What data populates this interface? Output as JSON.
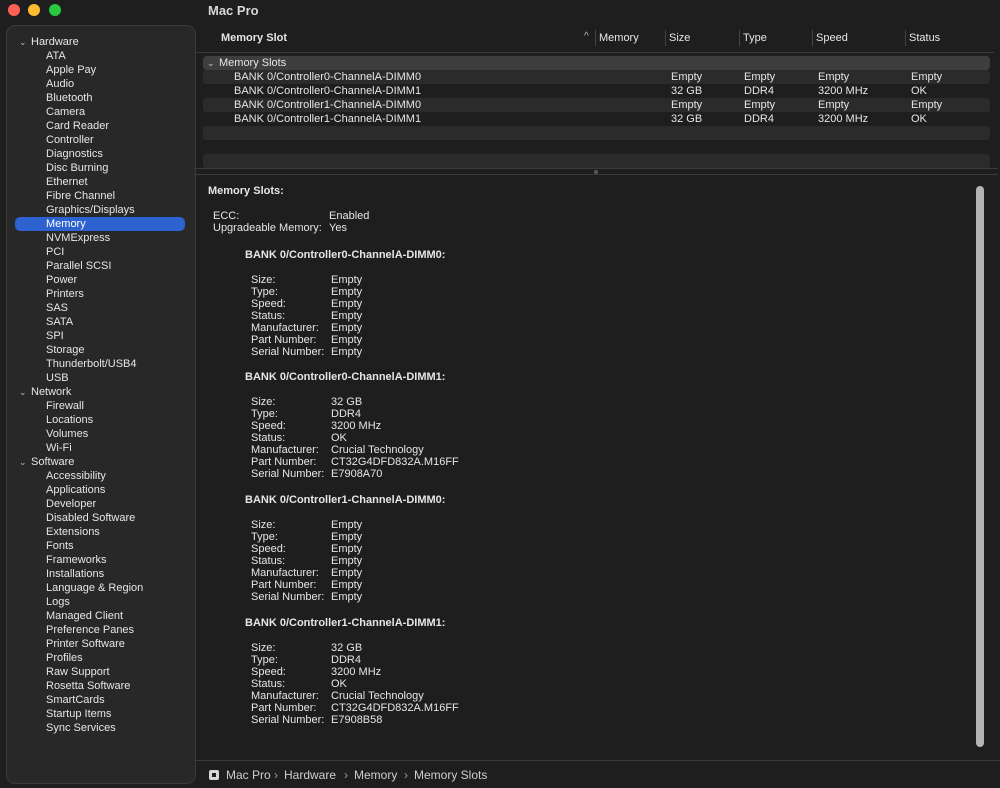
{
  "window": {
    "title": "Mac Pro"
  },
  "sidebar": {
    "hardware": {
      "label": "Hardware",
      "items": [
        "ATA",
        "Apple Pay",
        "Audio",
        "Bluetooth",
        "Camera",
        "Card Reader",
        "Controller",
        "Diagnostics",
        "Disc Burning",
        "Ethernet",
        "Fibre Channel",
        "Graphics/Displays",
        "Memory",
        "NVMExpress",
        "PCI",
        "Parallel SCSI",
        "Power",
        "Printers",
        "SAS",
        "SATA",
        "SPI",
        "Storage",
        "Thunderbolt/USB4",
        "USB"
      ],
      "selected": "Memory"
    },
    "network": {
      "label": "Network",
      "items": [
        "Firewall",
        "Locations",
        "Volumes",
        "Wi-Fi"
      ]
    },
    "software": {
      "label": "Software",
      "items": [
        "Accessibility",
        "Applications",
        "Developer",
        "Disabled Software",
        "Extensions",
        "Fonts",
        "Frameworks",
        "Installations",
        "Language & Region",
        "Logs",
        "Managed Client",
        "Preference Panes",
        "Printer Software",
        "Profiles",
        "Raw Support",
        "Rosetta Software",
        "SmartCards",
        "Startup Items",
        "Sync Services"
      ]
    }
  },
  "table": {
    "columns": [
      "Memory Slot",
      "Memory",
      "Size",
      "Type",
      "Speed",
      "Status"
    ],
    "sort_indicator": "^",
    "group_label": "Memory Slots",
    "rows": [
      {
        "slot": "BANK 0/Controller0-ChannelA-DIMM0",
        "size": "Empty",
        "type": "Empty",
        "speed": "Empty",
        "status": "Empty"
      },
      {
        "slot": "BANK 0/Controller0-ChannelA-DIMM1",
        "size": "32 GB",
        "type": "DDR4",
        "speed": "3200 MHz",
        "status": "OK"
      },
      {
        "slot": "BANK 0/Controller1-ChannelA-DIMM0",
        "size": "Empty",
        "type": "Empty",
        "speed": "Empty",
        "status": "Empty"
      },
      {
        "slot": "BANK 0/Controller1-ChannelA-DIMM1",
        "size": "32 GB",
        "type": "DDR4",
        "speed": "3200 MHz",
        "status": "OK"
      }
    ]
  },
  "detail": {
    "heading": "Memory Slots:",
    "summary": [
      {
        "key": "ECC:",
        "value": "Enabled"
      },
      {
        "key": "Upgradeable Memory:",
        "value": "Yes"
      }
    ],
    "slots": [
      {
        "title": "BANK 0/Controller0-ChannelA-DIMM0:",
        "fields": [
          {
            "key": "Size:",
            "value": "Empty"
          },
          {
            "key": "Type:",
            "value": "Empty"
          },
          {
            "key": "Speed:",
            "value": "Empty"
          },
          {
            "key": "Status:",
            "value": "Empty"
          },
          {
            "key": "Manufacturer:",
            "value": "Empty"
          },
          {
            "key": "Part Number:",
            "value": "Empty"
          },
          {
            "key": "Serial Number:",
            "value": "Empty"
          }
        ]
      },
      {
        "title": "BANK 0/Controller0-ChannelA-DIMM1:",
        "fields": [
          {
            "key": "Size:",
            "value": "32 GB"
          },
          {
            "key": "Type:",
            "value": "DDR4"
          },
          {
            "key": "Speed:",
            "value": "3200 MHz"
          },
          {
            "key": "Status:",
            "value": "OK"
          },
          {
            "key": "Manufacturer:",
            "value": "Crucial Technology"
          },
          {
            "key": "Part Number:",
            "value": "CT32G4DFD832A.M16FF"
          },
          {
            "key": "Serial Number:",
            "value": "E7908A70"
          }
        ]
      },
      {
        "title": "BANK 0/Controller1-ChannelA-DIMM0:",
        "fields": [
          {
            "key": "Size:",
            "value": "Empty"
          },
          {
            "key": "Type:",
            "value": "Empty"
          },
          {
            "key": "Speed:",
            "value": "Empty"
          },
          {
            "key": "Status:",
            "value": "Empty"
          },
          {
            "key": "Manufacturer:",
            "value": "Empty"
          },
          {
            "key": "Part Number:",
            "value": "Empty"
          },
          {
            "key": "Serial Number:",
            "value": "Empty"
          }
        ]
      },
      {
        "title": "BANK 0/Controller1-ChannelA-DIMM1:",
        "fields": [
          {
            "key": "Size:",
            "value": "32 GB"
          },
          {
            "key": "Type:",
            "value": "DDR4"
          },
          {
            "key": "Speed:",
            "value": "3200 MHz"
          },
          {
            "key": "Status:",
            "value": "OK"
          },
          {
            "key": "Manufacturer:",
            "value": "Crucial Technology"
          },
          {
            "key": "Part Number:",
            "value": "CT32G4DFD832A.M16FF"
          },
          {
            "key": "Serial Number:",
            "value": "E7908B58"
          }
        ]
      }
    ]
  },
  "pathbar": {
    "icon": "computer-icon",
    "crumbs": [
      "Mac Pro",
      "Hardware",
      "Memory",
      "Memory Slots"
    ],
    "separator": "›"
  },
  "colors": {
    "selection": "#2d62d0",
    "traffic_red": "#fe5f57",
    "traffic_yellow": "#febc2e",
    "traffic_green": "#28c840"
  }
}
